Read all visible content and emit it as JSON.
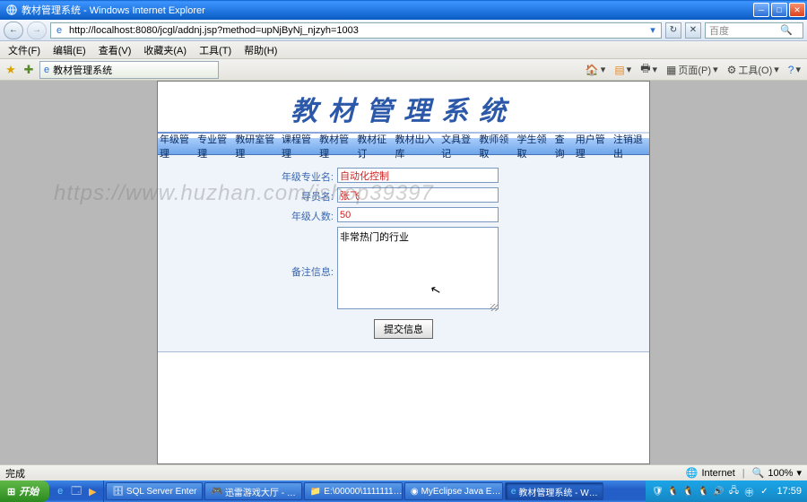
{
  "window": {
    "title": "教材管理系统 - Windows Internet Explorer",
    "url": "http://localhost:8080/jcgl/addnj.jsp?method=upNjByNj_njzyh=1003",
    "search_placeholder": "百度"
  },
  "menubar": {
    "file": "文件(F)",
    "edit": "编辑(E)",
    "view": "查看(V)",
    "favorites": "收藏夹(A)",
    "tools": "工具(T)",
    "help": "帮助(H)"
  },
  "tab": {
    "title": "教材管理系统"
  },
  "ietools": {
    "home": "",
    "print": "",
    "page": "页面(P)",
    "tools": "工具(O)"
  },
  "page": {
    "title": "教材管理系统",
    "nav": [
      "年级管理",
      "专业管理",
      "教研室管理",
      "课程管理",
      "教材管理",
      "教材征订",
      "教材出入库",
      "文具登记",
      "教师领取",
      "学生领取",
      "查询",
      "用户管理",
      "注销退出"
    ],
    "form": {
      "label_major": "年级专业名:",
      "value_major": "自动化控制",
      "label_tutor": "导员名:",
      "value_tutor": "张飞",
      "label_count": "年级人数:",
      "value_count": "50",
      "label_remark": "备注信息:",
      "value_remark": "非常热门的行业",
      "submit": "提交信息"
    }
  },
  "watermark": "https://www.huzhan.com/ishop39397",
  "statusbar": {
    "done": "完成",
    "zone": "Internet",
    "zoom": "100%"
  },
  "taskbar": {
    "start": "开始",
    "items": [
      {
        "label": "SQL Server Enter"
      },
      {
        "label": "迅雷游戏大厅 - …"
      },
      {
        "label": "E:\\00000\\1111111…"
      },
      {
        "label": "MyEclipse Java E…"
      },
      {
        "label": "教材管理系统 - W…"
      }
    ],
    "time": "17:59"
  }
}
